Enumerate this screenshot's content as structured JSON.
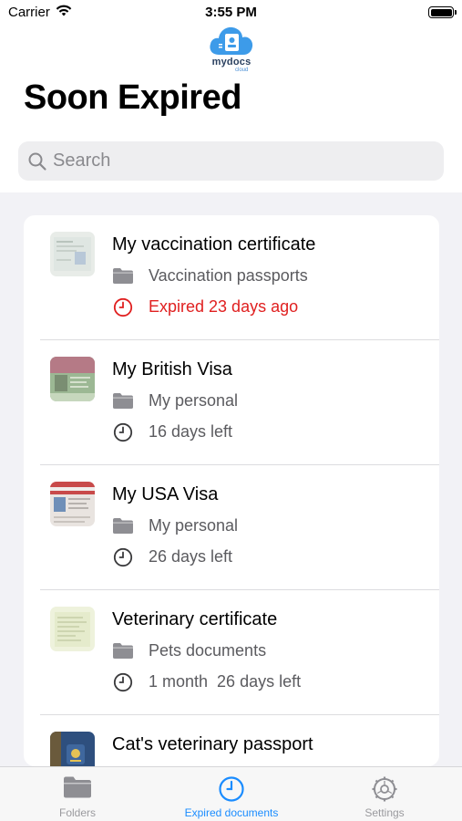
{
  "status_bar": {
    "carrier": "Carrier",
    "time": "3:55 PM"
  },
  "logo": {
    "name": "mydocs",
    "sub": "cloud"
  },
  "page_title": "Soon Expired",
  "search": {
    "placeholder": "Search"
  },
  "documents": [
    {
      "title": "My vaccination certificate",
      "folder": "Vaccination passports",
      "expiry": "Expired 23 days ago",
      "expired": true
    },
    {
      "title": "My British Visa",
      "folder": "My personal",
      "expiry": "16 days left",
      "expired": false
    },
    {
      "title": "My USA Visa",
      "folder": "My personal",
      "expiry": "26 days left",
      "expired": false
    },
    {
      "title": "Veterinary certificate",
      "folder": "Pets documents",
      "expiry": "1 month  26 days left",
      "expired": false
    },
    {
      "title": "Cat's veterinary passport",
      "folder": "",
      "expiry": "",
      "expired": false
    }
  ],
  "tabs": [
    {
      "label": "Folders",
      "icon": "folder-icon",
      "active": false
    },
    {
      "label": "Expired documents",
      "icon": "clock-icon",
      "active": true
    },
    {
      "label": "Settings",
      "icon": "gear-icon",
      "active": false
    }
  ],
  "colors": {
    "accent": "#1a8cff",
    "expired": "#e02020",
    "logo_blue": "#3d9be9"
  }
}
